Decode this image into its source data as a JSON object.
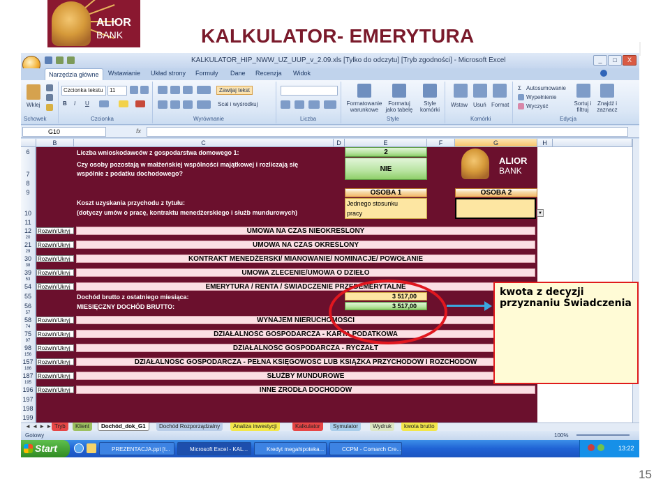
{
  "slide": {
    "title": "KALKULATOR- EMERYTURA",
    "page_number": "15",
    "logo_line1": "ALIOR",
    "logo_line2": "BANK"
  },
  "window": {
    "title": "KALKULATOR_HIP_NWW_UZ_UUP_v_2.09.xls [Tylko do odczytu] [Tryb zgodności] - Microsoft Excel",
    "controls": [
      "_",
      "□",
      "X"
    ]
  },
  "ribbon": {
    "tabs": [
      "Narzędzia główne",
      "Wstawianie",
      "Układ strony",
      "Formuły",
      "Dane",
      "Recenzja",
      "Widok"
    ],
    "active_tab": "Narzędzia główne",
    "groups": [
      "Schowek",
      "Czcionka",
      "Wyrównanie",
      "Liczba",
      "Style",
      "Komórki",
      "Edycja"
    ],
    "paste_label": "Wklej",
    "font_name": "Czcionka tekstu",
    "font_size": "11",
    "wrap_text": "Zawijaj tekst",
    "merge_center": "Scal i wyśrodkuj",
    "number_format": "",
    "format_conditional": "Formatowanie warunkowe",
    "format_table": "Formatuj jako tabelę",
    "cell_styles": "Style komórki",
    "insert": "Wstaw",
    "delete": "Usuń",
    "format": "Format",
    "autosum": "Autosumowanie",
    "fill": "Wypełnienie",
    "clear": "Wyczyść",
    "sort_filter": "Sortuj i filtruj",
    "find_select": "Znajdź i zaznacz"
  },
  "formula_bar": {
    "name_box": "G10",
    "fx": "fx",
    "content": ""
  },
  "columns": [
    "B",
    "C",
    "D",
    "E",
    "F",
    "G",
    "H"
  ],
  "rows": [
    "6",
    "7",
    "8",
    "9",
    "10",
    "11",
    "12",
    "20",
    "21",
    "29",
    "30",
    "38",
    "39",
    "53",
    "54",
    "55",
    "56",
    "57",
    "58",
    "74",
    "75",
    "97",
    "98",
    "156",
    "157",
    "186",
    "187",
    "195",
    "196",
    "197",
    "198",
    "199"
  ],
  "sheet": {
    "row6_label": "Liczba wnioskodawców z gospodarstwa domowego 1:",
    "row6_value": "2",
    "row7_label_1": "Czy osoby pozostają w małżeńskiej wspólności majątkowej i rozliczają się",
    "row7_label_2": "wspólnie z podatku dochodowego?",
    "row7_value": "NIE",
    "osoba1": "OSOBA 1",
    "osoba2": "OSOBA 2",
    "koszt_label_1": "Koszt uzyskania przychodu z tytułu:",
    "koszt_label_2": "(dotyczy umów o pracę, kontraktu menedżerskiego i służb mundurowych)",
    "osoba1_value_1": "Jednego stosunku",
    "osoba1_value_2": "pracy",
    "rozwin": "Rozwiń/Ukryj",
    "sections": [
      "UMOWA NA CZAS NIEOKREŚLONY",
      "UMOWA NA CZAS OKREŚLONY",
      "KONTRAKT MENEDŻERSKI/ MIANOWANIE/ NOMINACJE/ POWOŁANIE",
      "UMOWA ZLECENIE/UMOWA O DZIEŁO",
      "EMERYTURA / RENTA / ŚWIADCZENIE PRZEDEMERYTALNE",
      "WYNAJEM NIERUCHOMOŚCI",
      "DZIAŁALNOŚĆ GOSPODARCZA - KARTA PODATKOWA",
      "DZIAŁALNOŚĆ GOSPODARCZA - RYCZAŁT",
      "DZIAŁALNOŚĆ GOSPODARCZA - PEŁNA KSIĘGOWOŚĆ LUB KSIĄŻKA PRZYCHODÓW I ROZCHODÓW",
      "SŁUŻBY MUNDUROWE",
      "INNE ŹRÓDŁA DOCHODÓW"
    ],
    "dochod_label": "Dochód brutto z ostatniego miesiąca:",
    "dochod_value": "3 517,00",
    "miesieczny_label": "MIESIĘCZNY DOCHÓD BRUTTO:",
    "miesieczny_value": "3 517,00"
  },
  "sheet_tabs": [
    "Tryb",
    "Klient",
    "Dochód_dok_G1",
    "Dochód Rozporządzalny",
    "Analiza inwestycji",
    "Kalkulator",
    "Symulator",
    "Wydruk",
    "kwota brutto"
  ],
  "active_sheet": "Dochód_dok_G1",
  "status": {
    "text": "Gotowy",
    "zoom": "100%"
  },
  "taskbar": {
    "start": "Start",
    "items": [
      "PREZENTACJA.ppt [t...",
      "Microsoft Excel - KAL...",
      "Kredyt megahipoteka...",
      "CCPM - Comarch Cre..."
    ],
    "active_index": 1,
    "clock": "13:22"
  },
  "callout": {
    "text": "kwota z decyzji przyznaniu Świadczenia"
  },
  "colors": {
    "sheet_background": "#6b102d",
    "title_color": "#7a1a2b",
    "callout_border": "#e01c1c",
    "highlight_ellipse": "#e0171f",
    "arrow": "#3aa8e0"
  }
}
